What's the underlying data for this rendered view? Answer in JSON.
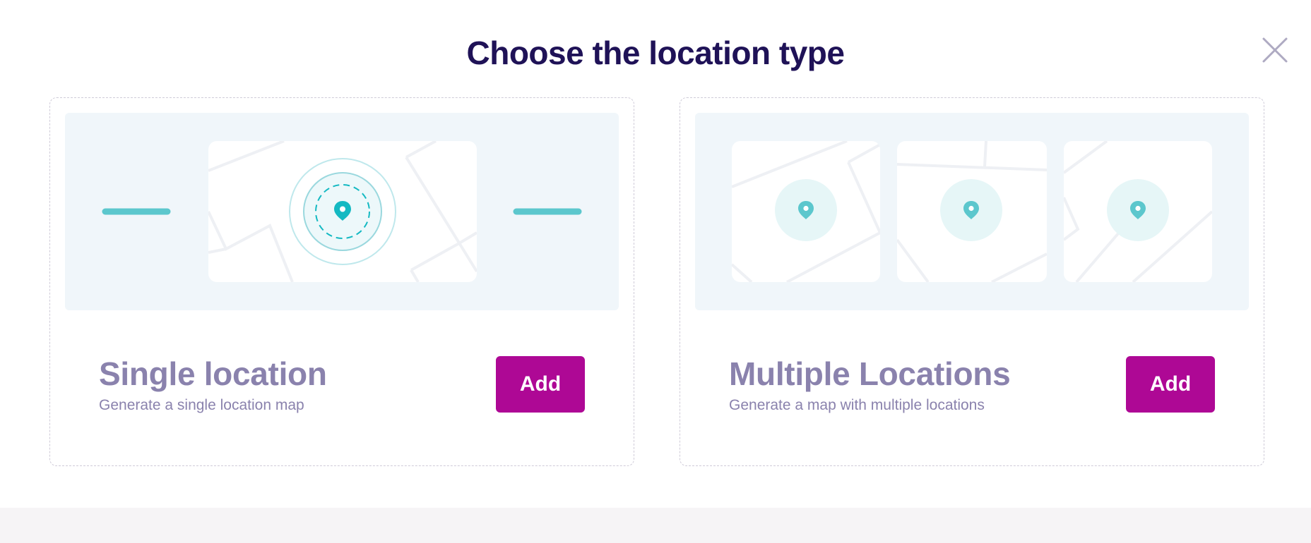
{
  "dialog": {
    "title": "Choose the location type",
    "close_icon": "close-icon"
  },
  "cards": [
    {
      "id": "single",
      "title": "Single location",
      "subtitle": "Generate a single location map",
      "button_label": "Add",
      "illustration": "single-location-map-illustration"
    },
    {
      "id": "multiple",
      "title": "Multiple Locations",
      "subtitle": "Generate a map with multiple locations",
      "button_label": "Add",
      "illustration": "multiple-locations-map-illustration"
    }
  ],
  "colors": {
    "title": "#1f1257",
    "card_text": "#8a82ad",
    "button": "#ae0895",
    "accent_teal": "#14b9c2",
    "illustration_bg": "#f0f6fa"
  }
}
